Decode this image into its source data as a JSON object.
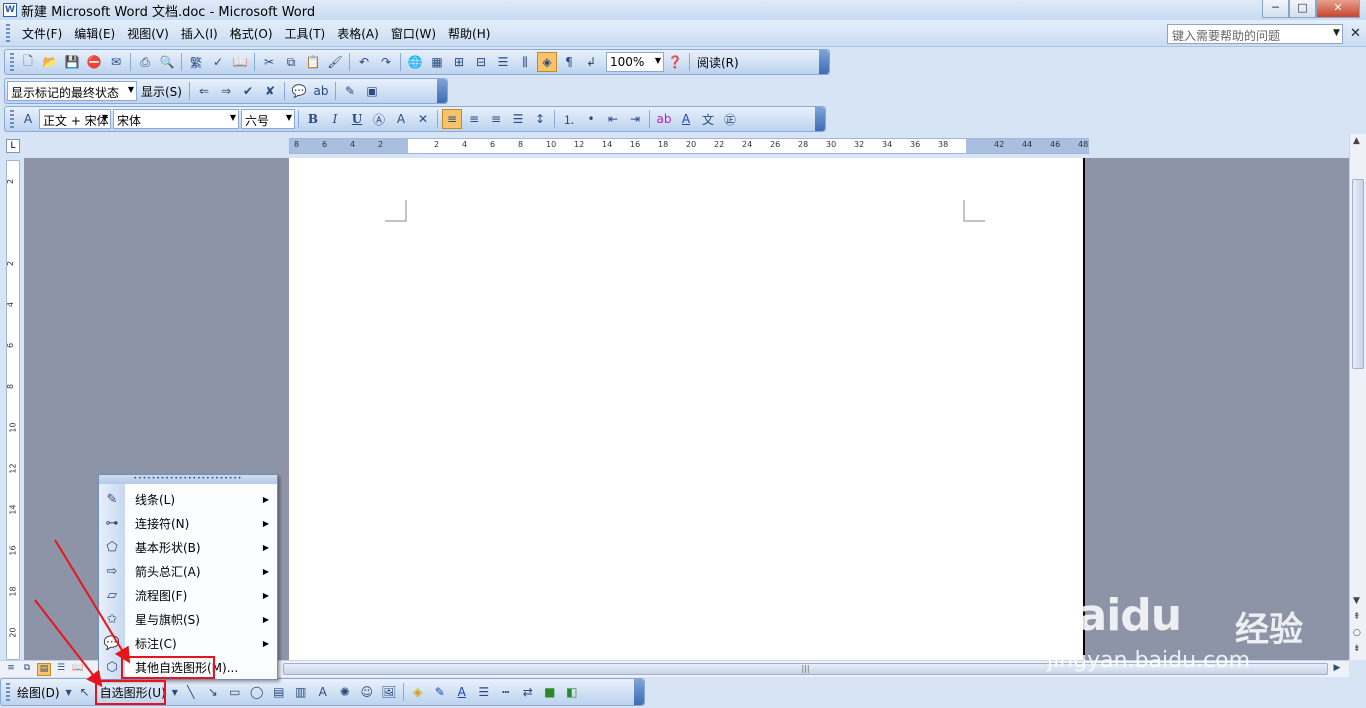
{
  "window": {
    "title": "新建 Microsoft Word 文档.doc - Microsoft Word",
    "minimize": "─",
    "maximize": "□",
    "close": "✕"
  },
  "menubar": {
    "items": [
      "文件(F)",
      "编辑(E)",
      "视图(V)",
      "插入(I)",
      "格式(O)",
      "工具(T)",
      "表格(A)",
      "窗口(W)",
      "帮助(H)"
    ],
    "help_placeholder": "键入需要帮助的问题"
  },
  "standard_toolbar": {
    "zoom": "100%",
    "read_label": "阅读(R)"
  },
  "reviewing_toolbar": {
    "markup_view": "显示标记的最终状态",
    "show_label": "显示(S)"
  },
  "formatting_toolbar": {
    "style": "正文 + 宋体",
    "font": "宋体",
    "size": "六号",
    "bold": "B",
    "italic": "I",
    "underline": "U"
  },
  "ruler": {
    "ticks": [
      "8",
      "6",
      "4",
      "2",
      "",
      "2",
      "4",
      "6",
      "8",
      "10",
      "12",
      "14",
      "16",
      "18",
      "20",
      "22",
      "24",
      "26",
      "28",
      "30",
      "32",
      "34",
      "36",
      "38",
      "",
      "42",
      "44",
      "46",
      "48"
    ],
    "vticks": [
      "2",
      "",
      "2",
      "4",
      "6",
      "8",
      "10",
      "12",
      "14",
      "16",
      "18",
      "20"
    ]
  },
  "autoshapes_menu": {
    "items": [
      {
        "label": "线条(L)",
        "icon": "lines-icon",
        "submenu": true
      },
      {
        "label": "连接符(N)",
        "icon": "connector-icon",
        "submenu": true
      },
      {
        "label": "基本形状(B)",
        "icon": "basic-shapes-icon",
        "submenu": true
      },
      {
        "label": "箭头总汇(A)",
        "icon": "block-arrows-icon",
        "submenu": true
      },
      {
        "label": "流程图(F)",
        "icon": "flowchart-icon",
        "submenu": true
      },
      {
        "label": "星与旗帜(S)",
        "icon": "stars-banners-icon",
        "submenu": true
      },
      {
        "label": "标注(C)",
        "icon": "callouts-icon",
        "submenu": true
      },
      {
        "label": "其他自选图形(M)...",
        "icon": "more-autoshapes-icon",
        "submenu": false
      }
    ]
  },
  "drawing_toolbar": {
    "draw_label": "绘图(D)",
    "autoshapes_label": "自选图形(U)"
  },
  "watermark": {
    "logo": "Baidu",
    "zh": "经验",
    "url": "jingyan.baidu.com"
  },
  "colors": {
    "annotation_red": "#e8141c",
    "workspace_gray": "#8d94a8",
    "toolbar_blue": "#bcd3ef"
  }
}
